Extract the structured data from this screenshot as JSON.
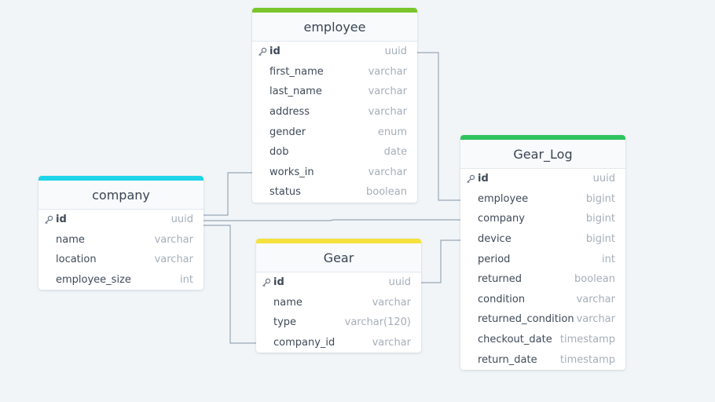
{
  "colors": {
    "background": "#f1f5f8",
    "connector": "#9aa6b4",
    "employee": "#7ac52b",
    "company": "#1ed4e8",
    "gear": "#f5e13e",
    "gear_log": "#2ec35f"
  },
  "tables": {
    "employee": {
      "title": "employee",
      "fields": [
        {
          "name": "id",
          "type": "uuid",
          "pk": true
        },
        {
          "name": "first_name",
          "type": "varchar"
        },
        {
          "name": "last_name",
          "type": "varchar"
        },
        {
          "name": "address",
          "type": "varchar"
        },
        {
          "name": "gender",
          "type": "enum"
        },
        {
          "name": "dob",
          "type": "date"
        },
        {
          "name": "works_in",
          "type": "varchar"
        },
        {
          "name": "status",
          "type": "boolean"
        }
      ]
    },
    "company": {
      "title": "company",
      "fields": [
        {
          "name": "id",
          "type": "uuid",
          "pk": true
        },
        {
          "name": "name",
          "type": "varchar"
        },
        {
          "name": "location",
          "type": "varchar"
        },
        {
          "name": "employee_size",
          "type": "int"
        }
      ]
    },
    "gear": {
      "title": "Gear",
      "fields": [
        {
          "name": "id",
          "type": "uuid",
          "pk": true
        },
        {
          "name": "name",
          "type": "varchar"
        },
        {
          "name": "type",
          "type": "varchar(120)"
        },
        {
          "name": "company_id",
          "type": "varchar"
        }
      ]
    },
    "gear_log": {
      "title": "Gear_Log",
      "fields": [
        {
          "name": "id",
          "type": "uuid",
          "pk": true
        },
        {
          "name": "employee",
          "type": "bigint"
        },
        {
          "name": "company",
          "type": "bigint"
        },
        {
          "name": "device",
          "type": "bigint"
        },
        {
          "name": "period",
          "type": "int"
        },
        {
          "name": "returned",
          "type": "boolean"
        },
        {
          "name": "condition",
          "type": "varchar"
        },
        {
          "name": "returned_condition",
          "type": "varchar"
        },
        {
          "name": "checkout_date",
          "type": "timestamp"
        },
        {
          "name": "return_date",
          "type": "timestamp"
        }
      ]
    }
  },
  "relationships": [
    {
      "from": "employee.id",
      "to": "gear_log.employee"
    },
    {
      "from": "company.id",
      "to": "employee.works_in"
    },
    {
      "from": "company.id",
      "to": "gear_log.company"
    },
    {
      "from": "company.id",
      "to": "gear.company_id"
    },
    {
      "from": "gear.id",
      "to": "gear_log.device"
    }
  ]
}
